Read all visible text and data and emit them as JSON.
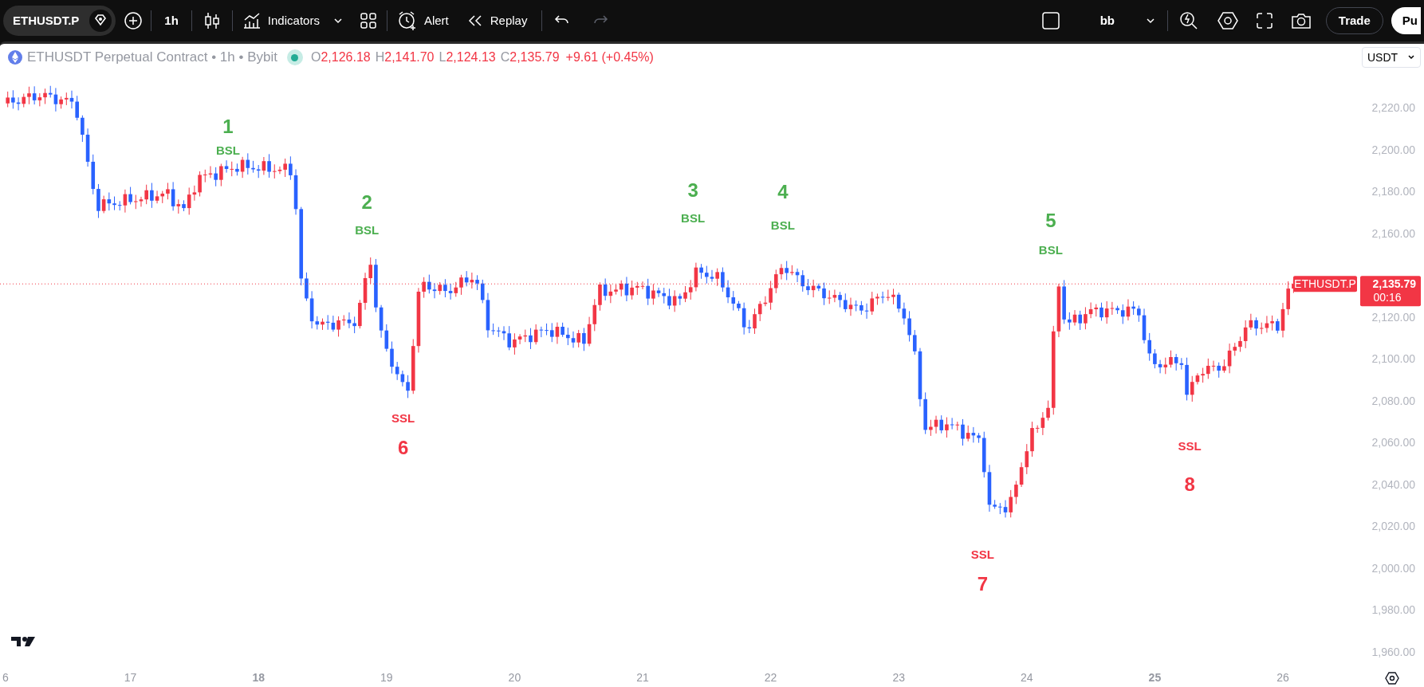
{
  "toolbar": {
    "symbol": "ETHUSDT.P",
    "interval": "1h",
    "indicators": "Indicators",
    "alert": "Alert",
    "replay": "Replay",
    "undo_disabled": false,
    "redo_disabled": true,
    "layout_name": "bb",
    "trade": "Trade",
    "publish": "Pu"
  },
  "legend": {
    "title": "ETHUSDT Perpetual Contract • 1h • Bybit",
    "ohlc": [
      {
        "label": "O",
        "value": "2,126.18"
      },
      {
        "label": "H",
        "value": "2,141.70"
      },
      {
        "label": "L",
        "value": "2,124.13"
      },
      {
        "label": "C",
        "value": "2,135.79"
      }
    ],
    "change": "+9.61 (+0.45%)"
  },
  "currency": "USDT",
  "price_axis": [
    "2,220.00",
    "2,200.00",
    "2,180.00",
    "2,160.00",
    "2,120.00",
    "2,100.00",
    "2,080.00",
    "2,060.00",
    "2,040.00",
    "2,020.00",
    "2,000.00",
    "1,980.00",
    "1,960.00"
  ],
  "time_axis": [
    {
      "label": "6",
      "emphasized": false
    },
    {
      "label": "17",
      "emphasized": false
    },
    {
      "label": "18",
      "emphasized": true
    },
    {
      "label": "19",
      "emphasized": false
    },
    {
      "label": "20",
      "emphasized": false
    },
    {
      "label": "21",
      "emphasized": false
    },
    {
      "label": "22",
      "emphasized": false
    },
    {
      "label": "23",
      "emphasized": false
    },
    {
      "label": "24",
      "emphasized": false
    },
    {
      "label": "25",
      "emphasized": true
    },
    {
      "label": "26",
      "emphasized": false
    }
  ],
  "price_label": {
    "symbol": "ETHUSDT.P",
    "price": "2,135.79",
    "countdown": "00:16"
  },
  "markers": [
    {
      "number": "1",
      "label": "BSL",
      "kind": "bsl"
    },
    {
      "number": "2",
      "label": "BSL",
      "kind": "bsl"
    },
    {
      "number": "3",
      "label": "BSL",
      "kind": "bsl"
    },
    {
      "number": "4",
      "label": "BSL",
      "kind": "bsl"
    },
    {
      "number": "5",
      "label": "BSL",
      "kind": "bsl"
    },
    {
      "number": "6",
      "label": "SSL",
      "kind": "ssl"
    },
    {
      "number": "7",
      "label": "SSL",
      "kind": "ssl"
    },
    {
      "number": "8",
      "label": "SSL",
      "kind": "ssl"
    }
  ]
}
